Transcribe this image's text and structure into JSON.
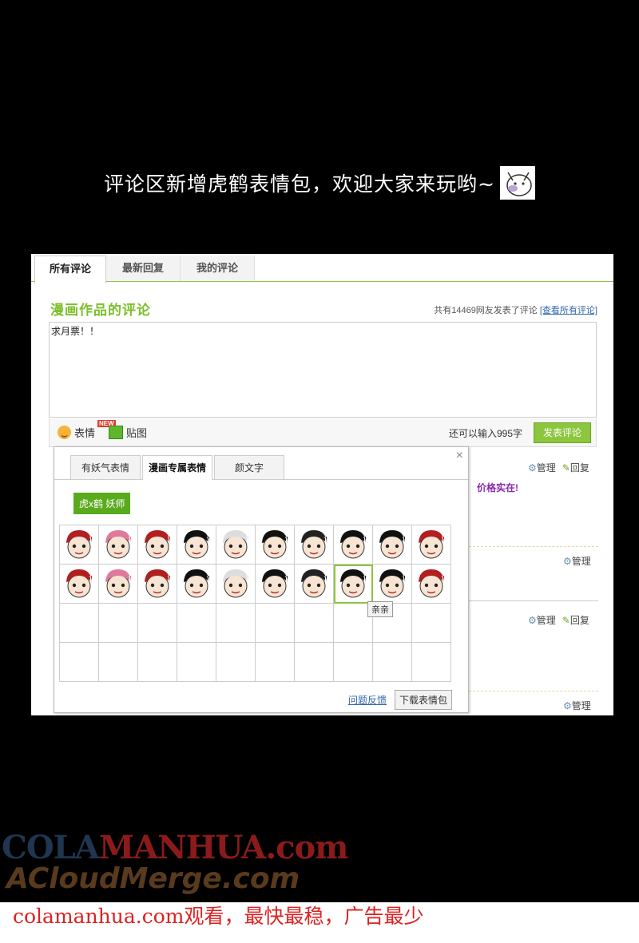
{
  "headline": "评论区新增虎鹤表情包，欢迎大家来玩哟~",
  "tabs": [
    "所有评论",
    "最新回复",
    "我的评论"
  ],
  "section": {
    "title": "漫画作品的评论",
    "meta_text": "共有14469网友发表了评论",
    "meta_link": "[查看所有评论]"
  },
  "input": {
    "value": "求月票！！"
  },
  "toolbar": {
    "emoji_label": "表情",
    "new_badge": "NEW",
    "sticker_label": "贴图",
    "remain": "还可以输入995字",
    "post_button": "发表评论"
  },
  "side_actions": {
    "manage": "管理",
    "reply": "回复",
    "purple_text": "价格实在!"
  },
  "emoji_panel": {
    "close": "×",
    "tabs": [
      "有妖气表情",
      "漫画专属表情",
      "颜文字"
    ],
    "active_tab": 1,
    "set_chip": "虎x鹤 妖师",
    "tooltip": "亲亲",
    "feedback_link": "问题反馈",
    "download_button": "下载表情包",
    "rows": 4,
    "cols": 10,
    "filled_cells": 20,
    "selected_cell": 17
  },
  "watermark": {
    "line1_a": "COLA",
    "line1_b": "MANHUA.com",
    "line2": "ACloudMerge.com",
    "bottom_text": "colamanhua.com观看，最快最稳，广告最少"
  }
}
